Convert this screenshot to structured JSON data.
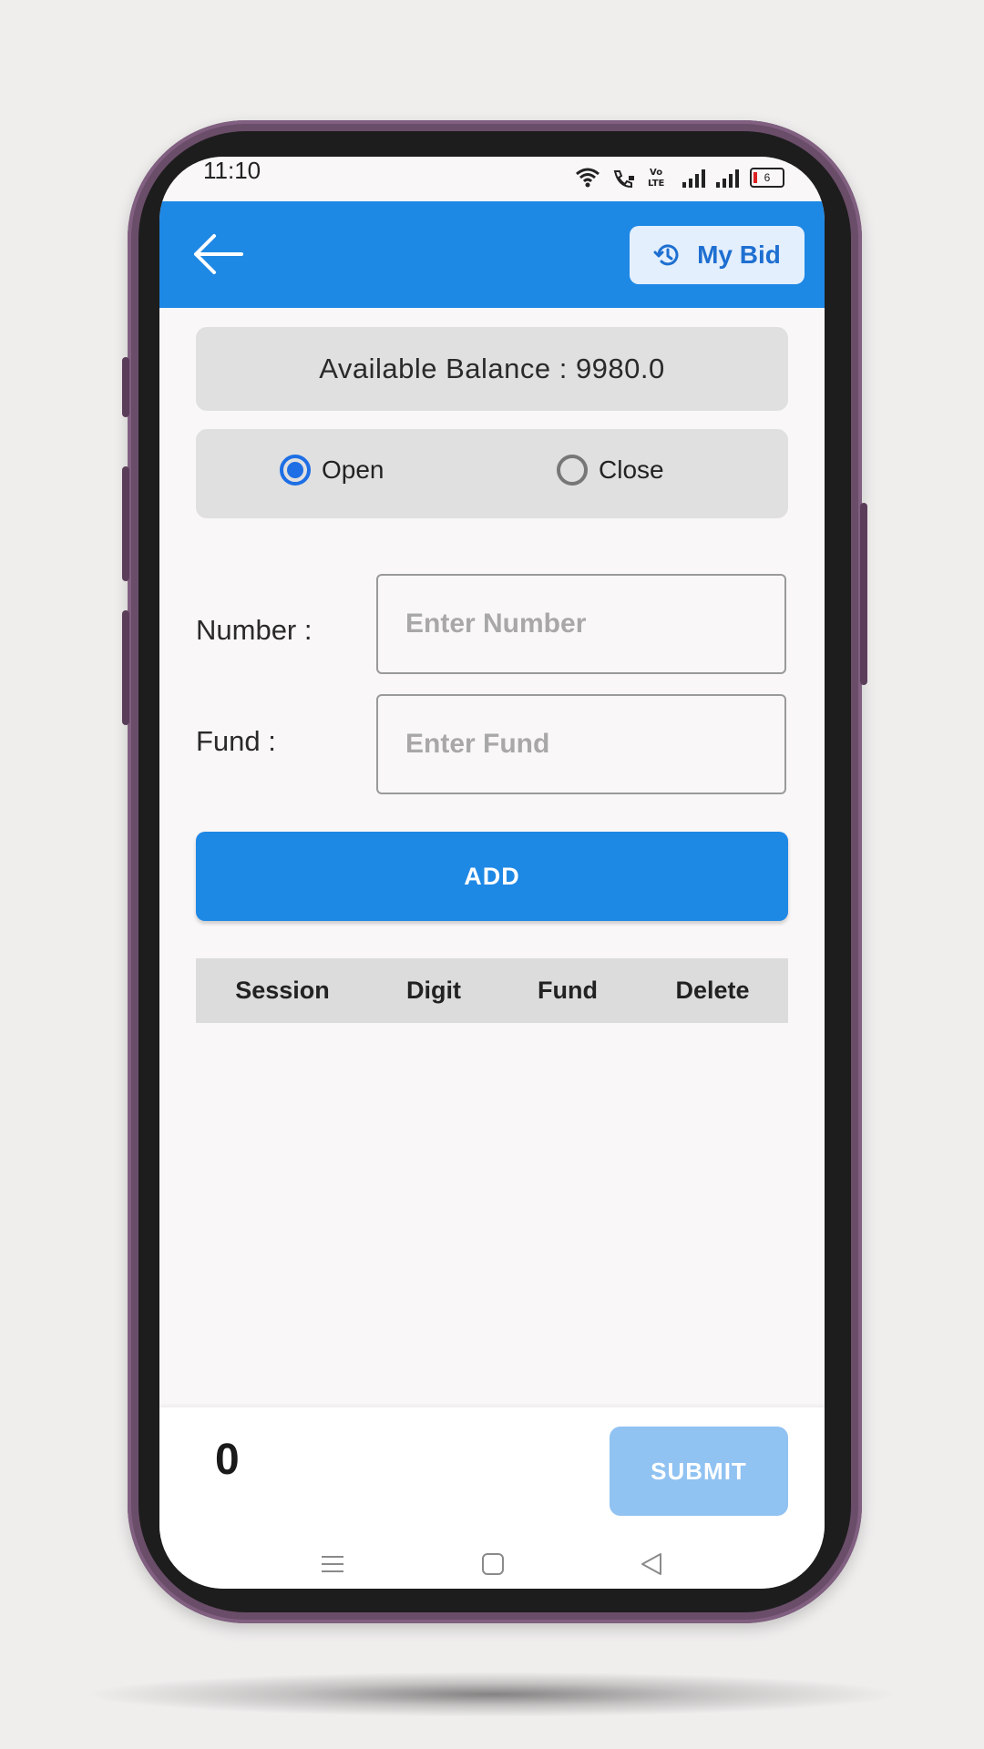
{
  "status_bar": {
    "time": "11:10",
    "battery_level": "6"
  },
  "header": {
    "back_icon": "arrow-left-icon",
    "my_bid_label": "My Bid",
    "my_bid_icon": "history-icon"
  },
  "balance": {
    "text": "Available Balance : 9980.0"
  },
  "session": {
    "options": [
      {
        "label": "Open",
        "selected": true
      },
      {
        "label": "Close",
        "selected": false
      }
    ]
  },
  "form": {
    "number_label": "Number :",
    "number_placeholder": "Enter Number",
    "number_value": "",
    "fund_label": "Fund :",
    "fund_placeholder": "Enter Fund",
    "fund_value": ""
  },
  "add_button": {
    "label": "ADD"
  },
  "table": {
    "columns": [
      "Session",
      "Digit",
      "Fund",
      "Delete"
    ],
    "rows": []
  },
  "footer": {
    "total": "0",
    "submit_label": "SUBMIT"
  },
  "colors": {
    "primary": "#1e88e5",
    "submit_disabled": "#90c2f2",
    "card_bg": "#e0e0e0",
    "phone_frame": "#6a4d69"
  }
}
